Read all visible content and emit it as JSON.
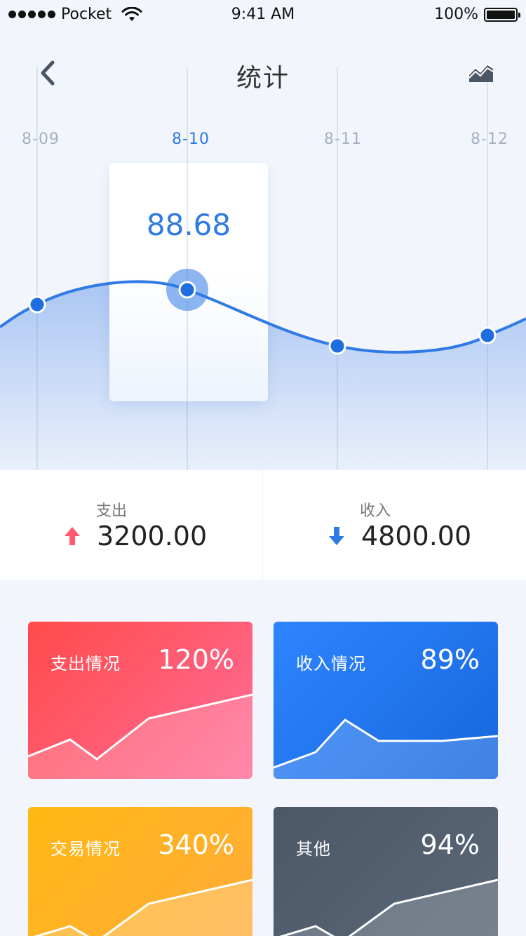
{
  "status_bar": {
    "carrier": "Pocket",
    "time": "9:41 AM",
    "battery": "100%"
  },
  "nav": {
    "title": "统计",
    "back_icon": "chevron-left-icon",
    "trend_icon": "trend-chart-icon"
  },
  "chart_data": {
    "type": "area",
    "categories": [
      "8-09",
      "8-10",
      "8-11",
      "8-12"
    ],
    "series": [
      {
        "values": [
          null,
          88.68,
          null,
          null
        ]
      }
    ],
    "selected_index": 1,
    "selected_value": "88.68"
  },
  "summary": {
    "expense": {
      "label": "支出",
      "value": "3200.00",
      "icon": "arrow-up-icon"
    },
    "income": {
      "label": "收入",
      "value": "4800.00",
      "icon": "arrow-down-icon"
    }
  },
  "cards": [
    {
      "title": "支出情况",
      "percent": "120%",
      "color": "#ff5a6e"
    },
    {
      "title": "收入情况",
      "percent": "89%",
      "color": "#2577f0"
    },
    {
      "title": "交易情况",
      "percent": "340%",
      "color": "#ffb324"
    },
    {
      "title": "其他",
      "percent": "94%",
      "color": "#535f6f"
    }
  ],
  "colors": {
    "accent": "#2f7ae5",
    "expense_arrow": "#ff5a6e",
    "income_arrow": "#2f7ae5"
  }
}
